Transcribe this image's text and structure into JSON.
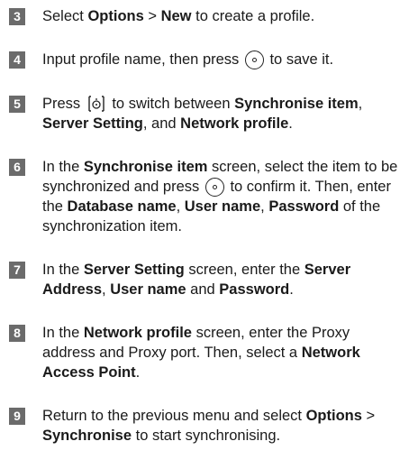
{
  "steps": [
    {
      "number": "3",
      "parts": [
        "Select ",
        "Options",
        " > ",
        "New",
        " to create a profile."
      ]
    },
    {
      "number": "4",
      "parts": [
        "Input profile name, then press ",
        " to save it."
      ]
    },
    {
      "number": "5",
      "parts": [
        "Press ",
        " to switch between ",
        "Synchronise item",
        ", ",
        "Server Setting",
        ", and ",
        "Network profile",
        "."
      ]
    },
    {
      "number": "6",
      "parts": [
        "In the ",
        "Synchronise item",
        " screen, select the item to be synchronized and press ",
        " to confirm it. Then, enter the ",
        "Database name",
        ", ",
        "User name",
        ", ",
        "Password",
        " of the synchronization item."
      ]
    },
    {
      "number": "7",
      "parts": [
        "In the ",
        "Server Setting",
        " screen, enter the ",
        "Server Address",
        ", ",
        "User name",
        " and ",
        "Password",
        "."
      ]
    },
    {
      "number": "8",
      "parts": [
        "In the ",
        "Network profile",
        " screen, enter the Proxy address and Proxy port. Then, select a ",
        "Network Access Point",
        "."
      ]
    },
    {
      "number": "9",
      "parts": [
        "Return to the previous menu and select ",
        "Options",
        " > ",
        "Synchronise",
        " to start synchronising."
      ]
    }
  ],
  "icons": {
    "ok": "ok-key-icon",
    "nav": "navigation-key-icon"
  }
}
